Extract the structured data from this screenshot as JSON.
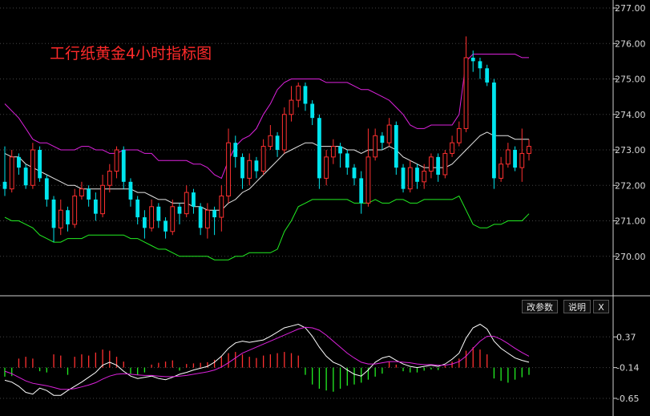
{
  "chart_data": [
    {
      "type": "candlestick",
      "title": "工行纸黄金4小时指标图",
      "ylim": [
        269.0,
        277.0
      ],
      "yticks": [
        "277.00",
        "276.00",
        "275.00",
        "274.00",
        "273.00",
        "272.00",
        "271.00",
        "270.00"
      ],
      "grid": true,
      "colors": {
        "up": "#ff3030",
        "down": "#00e5ee",
        "mid_band": "#e6e6e6",
        "upper_band": "#dd22dd",
        "lower_band": "#22ee22",
        "grid": "#444444"
      },
      "candles": [
        [
          272.1,
          271.9,
          273.1,
          271.7
        ],
        [
          271.9,
          272.8,
          273.0,
          271.8
        ],
        [
          272.8,
          272.5,
          272.9,
          272.3
        ],
        [
          272.5,
          272.0,
          272.6,
          271.9
        ],
        [
          272.0,
          273.0,
          273.2,
          271.9
        ],
        [
          273.0,
          272.2,
          273.1,
          272.1
        ],
        [
          272.2,
          271.6,
          272.3,
          271.4
        ],
        [
          271.6,
          270.8,
          271.7,
          270.4
        ],
        [
          270.8,
          271.3,
          271.6,
          270.6
        ],
        [
          271.3,
          270.9,
          271.4,
          270.7
        ],
        [
          270.9,
          271.7,
          271.9,
          270.8
        ],
        [
          271.7,
          271.9,
          272.1,
          271.6
        ],
        [
          271.9,
          271.6,
          272.0,
          271.4
        ],
        [
          271.6,
          271.2,
          271.8,
          271.0
        ],
        [
          271.2,
          272.0,
          272.3,
          271.1
        ],
        [
          272.0,
          272.4,
          272.6,
          271.8
        ],
        [
          272.4,
          273.0,
          273.1,
          272.2
        ],
        [
          273.0,
          272.1,
          273.1,
          271.9
        ],
        [
          272.1,
          271.6,
          272.2,
          271.4
        ],
        [
          271.6,
          271.1,
          271.7,
          270.9
        ],
        [
          271.1,
          270.8,
          271.3,
          270.5
        ],
        [
          270.8,
          271.4,
          271.6,
          270.7
        ],
        [
          271.4,
          271.0,
          271.5,
          270.8
        ],
        [
          271.0,
          270.7,
          271.1,
          270.5
        ],
        [
          270.7,
          271.4,
          271.6,
          270.6
        ],
        [
          271.4,
          271.2,
          271.5,
          270.9
        ],
        [
          271.2,
          271.8,
          272.0,
          271.1
        ],
        [
          271.8,
          271.4,
          271.9,
          271.2
        ],
        [
          271.4,
          270.8,
          271.5,
          270.6
        ],
        [
          270.8,
          271.3,
          271.5,
          270.5
        ],
        [
          271.3,
          271.1,
          271.4,
          270.6
        ],
        [
          271.1,
          271.7,
          272.0,
          270.7
        ],
        [
          271.7,
          273.2,
          273.6,
          271.5
        ],
        [
          273.2,
          272.8,
          273.4,
          272.5
        ],
        [
          272.8,
          272.2,
          272.9,
          271.9
        ],
        [
          272.2,
          272.7,
          272.9,
          272.0
        ],
        [
          272.7,
          272.4,
          272.8,
          272.2
        ],
        [
          272.4,
          273.1,
          273.3,
          272.3
        ],
        [
          273.1,
          273.4,
          273.7,
          273.0
        ],
        [
          273.4,
          273.0,
          273.5,
          272.8
        ],
        [
          273.0,
          274.0,
          274.2,
          272.9
        ],
        [
          274.0,
          274.4,
          274.8,
          273.8
        ],
        [
          274.4,
          274.8,
          274.9,
          274.2
        ],
        [
          274.8,
          274.3,
          274.9,
          274.1
        ],
        [
          274.3,
          273.9,
          274.4,
          273.7
        ],
        [
          273.9,
          272.2,
          274.0,
          271.9
        ],
        [
          272.2,
          272.8,
          273.0,
          272.0
        ],
        [
          272.8,
          273.1,
          273.3,
          272.6
        ],
        [
          273.1,
          272.9,
          273.2,
          272.5
        ],
        [
          272.9,
          272.5,
          273.0,
          272.3
        ],
        [
          272.5,
          272.2,
          272.6,
          272.0
        ],
        [
          272.2,
          271.5,
          272.4,
          271.2
        ],
        [
          271.5,
          272.8,
          273.6,
          271.4
        ],
        [
          272.8,
          273.4,
          273.6,
          272.7
        ],
        [
          273.4,
          273.2,
          273.5,
          273.0
        ],
        [
          273.2,
          273.7,
          273.9,
          273.1
        ],
        [
          273.7,
          272.5,
          273.8,
          272.3
        ],
        [
          272.5,
          271.9,
          272.6,
          271.8
        ],
        [
          271.9,
          272.5,
          272.7,
          271.8
        ],
        [
          272.5,
          272.1,
          272.6,
          271.9
        ],
        [
          272.1,
          272.4,
          272.6,
          271.9
        ],
        [
          272.4,
          272.8,
          272.9,
          272.2
        ],
        [
          272.8,
          272.3,
          272.9,
          272.1
        ],
        [
          272.3,
          272.9,
          273.0,
          272.2
        ],
        [
          272.9,
          273.2,
          273.4,
          272.8
        ],
        [
          273.2,
          273.6,
          273.8,
          273.1
        ],
        [
          273.6,
          275.6,
          276.2,
          273.5
        ],
        [
          275.6,
          275.5,
          275.8,
          275.2
        ],
        [
          275.5,
          275.3,
          275.6,
          275.0
        ],
        [
          275.3,
          274.9,
          275.4,
          274.8
        ],
        [
          274.9,
          272.2,
          275.0,
          271.9
        ],
        [
          272.2,
          272.6,
          272.8,
          272.1
        ],
        [
          272.6,
          273.0,
          273.2,
          272.5
        ],
        [
          273.0,
          272.5,
          273.1,
          272.4
        ],
        [
          272.5,
          272.9,
          273.6,
          272.1
        ],
        [
          272.9,
          273.1,
          273.3,
          272.7
        ]
      ],
      "bands": {
        "upper": [
          274.3,
          274.1,
          273.9,
          273.6,
          273.3,
          273.2,
          273.2,
          273.1,
          273.0,
          273.0,
          273.0,
          273.1,
          273.1,
          273.0,
          273.0,
          272.9,
          272.9,
          273.0,
          273.0,
          273.0,
          272.9,
          272.9,
          272.7,
          272.7,
          272.7,
          272.7,
          272.7,
          272.6,
          272.6,
          272.5,
          272.3,
          272.2,
          272.7,
          273.1,
          273.3,
          273.4,
          273.6,
          274.0,
          274.3,
          274.7,
          274.9,
          275.0,
          275.0,
          275.0,
          275.0,
          275.0,
          274.9,
          274.9,
          274.9,
          274.9,
          274.8,
          274.7,
          274.7,
          274.6,
          274.5,
          274.4,
          274.2,
          274.0,
          273.7,
          273.6,
          273.6,
          273.7,
          273.7,
          273.7,
          273.7,
          274.0,
          275.5,
          275.7,
          275.7,
          275.7,
          275.7,
          275.7,
          275.7,
          275.7,
          275.6,
          275.6
        ],
        "mid": [
          272.9,
          272.8,
          272.8,
          272.6,
          272.5,
          272.4,
          272.3,
          272.2,
          272.1,
          272.0,
          272.0,
          271.9,
          271.9,
          271.9,
          271.9,
          271.9,
          271.9,
          271.9,
          271.9,
          271.8,
          271.8,
          271.7,
          271.6,
          271.6,
          271.5,
          271.5,
          271.5,
          271.4,
          271.4,
          271.3,
          271.3,
          271.3,
          271.5,
          271.6,
          271.8,
          271.9,
          272.1,
          272.3,
          272.5,
          272.7,
          272.9,
          273.0,
          273.1,
          273.2,
          273.2,
          273.1,
          273.1,
          273.1,
          273.1,
          273.0,
          273.0,
          272.9,
          273.0,
          273.0,
          273.0,
          273.1,
          273.0,
          272.8,
          272.7,
          272.6,
          272.5,
          272.5,
          272.5,
          272.5,
          272.6,
          272.8,
          273.0,
          273.2,
          273.4,
          273.5,
          273.4,
          273.4,
          273.4,
          273.3,
          273.3,
          273.3
        ],
        "lower": [
          271.1,
          271.0,
          271.0,
          270.9,
          270.8,
          270.6,
          270.5,
          270.4,
          270.4,
          270.5,
          270.5,
          270.5,
          270.6,
          270.6,
          270.6,
          270.6,
          270.6,
          270.6,
          270.5,
          270.5,
          270.4,
          270.3,
          270.2,
          270.2,
          270.1,
          270.0,
          270.0,
          270.0,
          270.0,
          270.0,
          269.9,
          269.9,
          269.9,
          270.0,
          270.0,
          270.1,
          270.1,
          270.1,
          270.1,
          270.2,
          270.7,
          271.0,
          271.4,
          271.5,
          271.6,
          271.6,
          271.6,
          271.6,
          271.6,
          271.6,
          271.5,
          271.5,
          271.5,
          271.6,
          271.5,
          271.5,
          271.6,
          271.6,
          271.5,
          271.5,
          271.6,
          271.6,
          271.6,
          271.6,
          271.6,
          271.7,
          271.3,
          270.9,
          270.8,
          270.8,
          270.9,
          270.9,
          271.0,
          271.0,
          271.0,
          271.2
        ]
      }
    },
    {
      "type": "macd",
      "yticks": [
        "0.37",
        "-0.14",
        "-0.65"
      ],
      "ylim": [
        -0.85,
        0.72
      ],
      "colors": {
        "diff": "#ffffff",
        "dea": "#dd22dd",
        "positive": "#ff3030",
        "negative": "#22ee22"
      },
      "diff": [
        -0.35,
        -0.38,
        -0.45,
        -0.55,
        -0.58,
        -0.48,
        -0.52,
        -0.6,
        -0.6,
        -0.52,
        -0.45,
        -0.38,
        -0.3,
        -0.22,
        -0.1,
        -0.05,
        -0.1,
        -0.2,
        -0.28,
        -0.32,
        -0.3,
        -0.28,
        -0.32,
        -0.34,
        -0.3,
        -0.25,
        -0.22,
        -0.18,
        -0.15,
        -0.12,
        -0.05,
        0.05,
        0.18,
        0.27,
        0.3,
        0.28,
        0.3,
        0.32,
        0.38,
        0.45,
        0.52,
        0.55,
        0.58,
        0.52,
        0.38,
        0.2,
        0.05,
        -0.05,
        -0.1,
        -0.18,
        -0.25,
        -0.28,
        -0.18,
        -0.05,
        0.02,
        0.05,
        -0.02,
        -0.08,
        -0.12,
        -0.14,
        -0.12,
        -0.1,
        -0.12,
        -0.08,
        0.0,
        0.1,
        0.35,
        0.52,
        0.58,
        0.5,
        0.3,
        0.18,
        0.1,
        0.02,
        -0.02,
        -0.05
      ],
      "dea": [
        -0.2,
        -0.24,
        -0.3,
        -0.36,
        -0.4,
        -0.42,
        -0.44,
        -0.47,
        -0.5,
        -0.5,
        -0.49,
        -0.46,
        -0.43,
        -0.39,
        -0.33,
        -0.28,
        -0.25,
        -0.24,
        -0.25,
        -0.26,
        -0.27,
        -0.27,
        -0.28,
        -0.29,
        -0.29,
        -0.28,
        -0.27,
        -0.25,
        -0.23,
        -0.21,
        -0.18,
        -0.13,
        -0.06,
        0.02,
        0.1,
        0.15,
        0.2,
        0.25,
        0.3,
        0.35,
        0.4,
        0.45,
        0.5,
        0.53,
        0.52,
        0.48,
        0.4,
        0.3,
        0.2,
        0.1,
        0.02,
        -0.05,
        -0.08,
        -0.08,
        -0.06,
        -0.04,
        -0.04,
        -0.05,
        -0.06,
        -0.08,
        -0.09,
        -0.09,
        -0.1,
        -0.1,
        -0.08,
        -0.04,
        0.05,
        0.18,
        0.3,
        0.38,
        0.38,
        0.33,
        0.26,
        0.18,
        0.11,
        0.05
      ],
      "histogram": [
        -0.15,
        -0.14,
        0.15,
        0.18,
        0.15,
        -0.06,
        -0.08,
        0.22,
        0.2,
        -0.12,
        0.18,
        0.22,
        0.2,
        0.25,
        0.3,
        0.28,
        0.18,
        0.1,
        -0.1,
        -0.12,
        -0.08,
        0.05,
        0.08,
        0.1,
        0.12,
        -0.05,
        0.06,
        0.07,
        0.08,
        0.09,
        0.13,
        0.18,
        0.24,
        0.26,
        0.22,
        0.18,
        0.16,
        0.2,
        0.22,
        0.24,
        0.26,
        0.24,
        0.2,
        -0.12,
        -0.28,
        -0.35,
        -0.38,
        -0.4,
        -0.35,
        -0.3,
        -0.28,
        -0.25,
        -0.2,
        -0.15,
        -0.1,
        0.1,
        0.05,
        -0.06,
        -0.08,
        -0.08,
        -0.05,
        -0.03,
        -0.04,
        0.03,
        0.1,
        0.15,
        0.28,
        0.34,
        0.3,
        0.22,
        -0.18,
        -0.22,
        -0.25,
        -0.2,
        -0.16,
        -0.12
      ]
    }
  ],
  "panel_buttons": {
    "params": "改参数",
    "help": "说明",
    "close": "X"
  }
}
